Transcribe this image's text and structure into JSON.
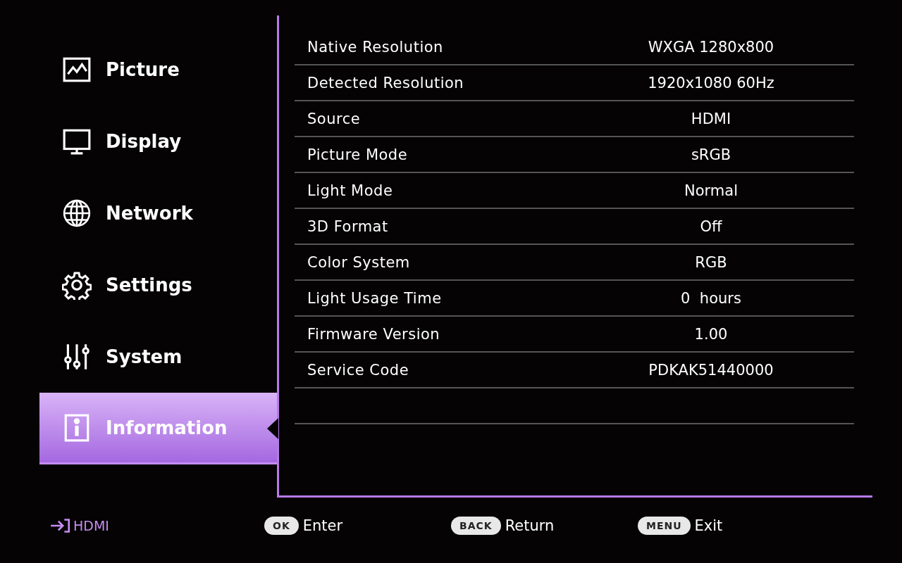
{
  "menu": [
    {
      "label": "Picture",
      "kind": "picture",
      "selected": false
    },
    {
      "label": "Display",
      "kind": "display",
      "selected": false
    },
    {
      "label": "Network",
      "kind": "network",
      "selected": false
    },
    {
      "label": "Settings",
      "kind": "settings",
      "selected": false
    },
    {
      "label": "System",
      "kind": "system",
      "selected": false
    },
    {
      "label": "Information",
      "kind": "info",
      "selected": true
    }
  ],
  "info_rows": [
    {
      "label": "Native Resolution",
      "value": "WXGA 1280x800"
    },
    {
      "label": "Detected Resolution",
      "value": "1920x1080 60Hz"
    },
    {
      "label": "Source",
      "value": "HDMI"
    },
    {
      "label": "Picture Mode",
      "value": "sRGB"
    },
    {
      "label": "Light Mode",
      "value": "Normal"
    },
    {
      "label": "3D Format",
      "value": "Off"
    },
    {
      "label": "Color System",
      "value": "RGB"
    },
    {
      "label": "Light Usage Time",
      "value": "0  hours"
    },
    {
      "label": "Firmware Version",
      "value": "1.00"
    },
    {
      "label": "Service Code",
      "value": "PDKAK51440000"
    }
  ],
  "footer": {
    "source": "HDMI",
    "hints": [
      {
        "key": "OK",
        "action": "Enter"
      },
      {
        "key": "BACK",
        "action": "Return"
      },
      {
        "key": "MENU",
        "action": "Exit"
      }
    ]
  }
}
